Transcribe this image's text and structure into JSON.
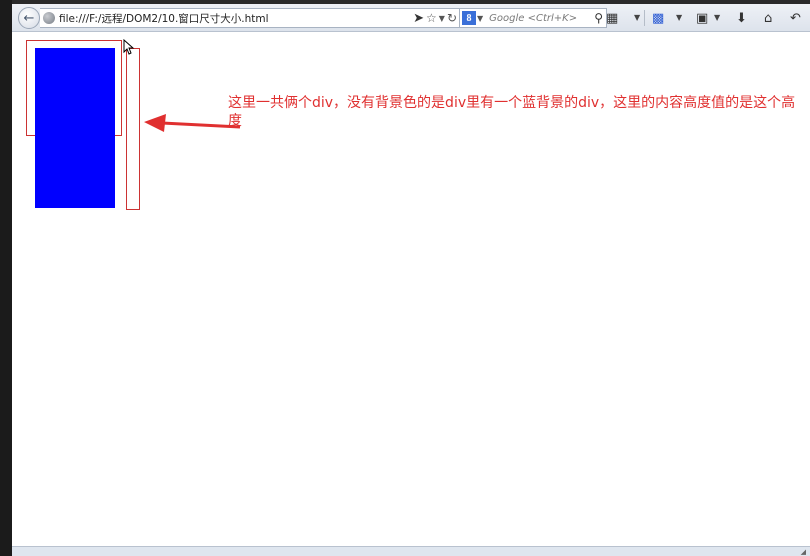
{
  "browser": {
    "url": "file:///F:/远程/DOM2/10.窗口尺寸大小.html",
    "back_icon": "back-arrow-icon",
    "search": {
      "placeholder": "Google <Ctrl+K>"
    },
    "toolbar_icons": [
      "site-identity-icon",
      "bookmark-star-icon",
      "dropdown-icon",
      "reload-icon",
      "search-engine-icon",
      "developer-tools-icon",
      "addons-icon",
      "extension-icon",
      "downloads-icon",
      "home-icon",
      "undo-icon"
    ]
  },
  "page": {
    "annotation": "这里一共俩个div，没有背景色的是div里有一个蓝背景的div，这里的内容高度值的是这个高度",
    "colors": {
      "blue_box": "#0000ff",
      "outline": "#cc3333",
      "annotation": "#e03030"
    }
  }
}
